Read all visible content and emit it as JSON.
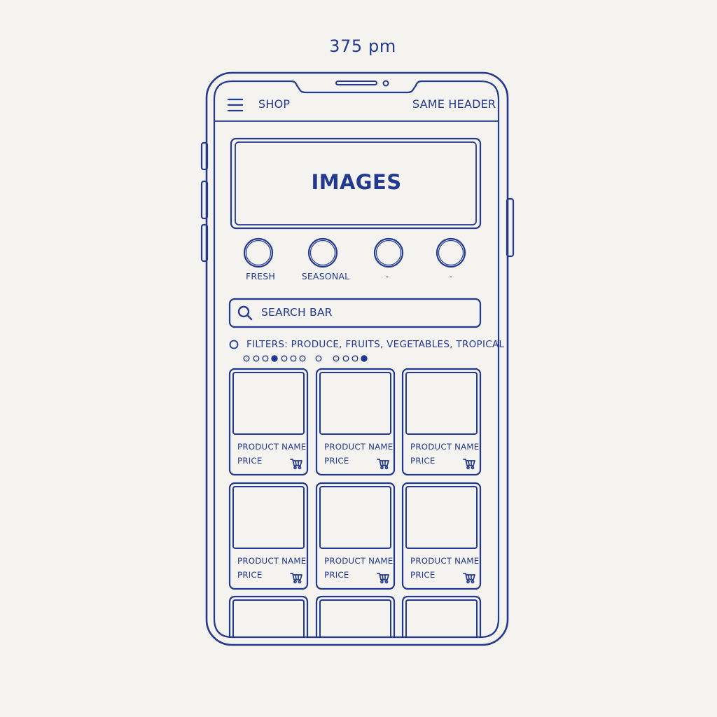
{
  "dimension_label": "375 pm",
  "header": {
    "menu_icon": "hamburger-menu-icon",
    "left_title": "SHOP",
    "right_title": "SAME HEADER"
  },
  "hero": {
    "label": "IMAGES"
  },
  "categories": [
    {
      "label": "FRESH"
    },
    {
      "label": "SEASONAL"
    },
    {
      "label": "-"
    },
    {
      "label": "-"
    }
  ],
  "search": {
    "icon": "search-icon",
    "placeholder": "SEARCH BAR"
  },
  "filters": {
    "label": "FILTERS: PRODUCE,  FRUITS,  VEGETABLES,  TROPICAL"
  },
  "products": [
    {
      "name": "PRODUCT NAME",
      "price": "PRICE",
      "icon": "cart-icon"
    },
    {
      "name": "PRODUCT NAME",
      "price": "PRICE",
      "icon": "cart-icon"
    },
    {
      "name": "PRODUCT NAME",
      "price": "PRICE",
      "icon": "cart-icon"
    },
    {
      "name": "PRODUCT NAME",
      "price": "PRICE",
      "icon": "cart-icon"
    },
    {
      "name": "PRODUCT NAME",
      "price": "PRICE",
      "icon": "cart-icon"
    },
    {
      "name": "PRODUCT NAME",
      "price": "PRICE",
      "icon": "cart-icon"
    }
  ],
  "colors": {
    "ink": "#23398f",
    "paper": "#f4f3ef"
  }
}
